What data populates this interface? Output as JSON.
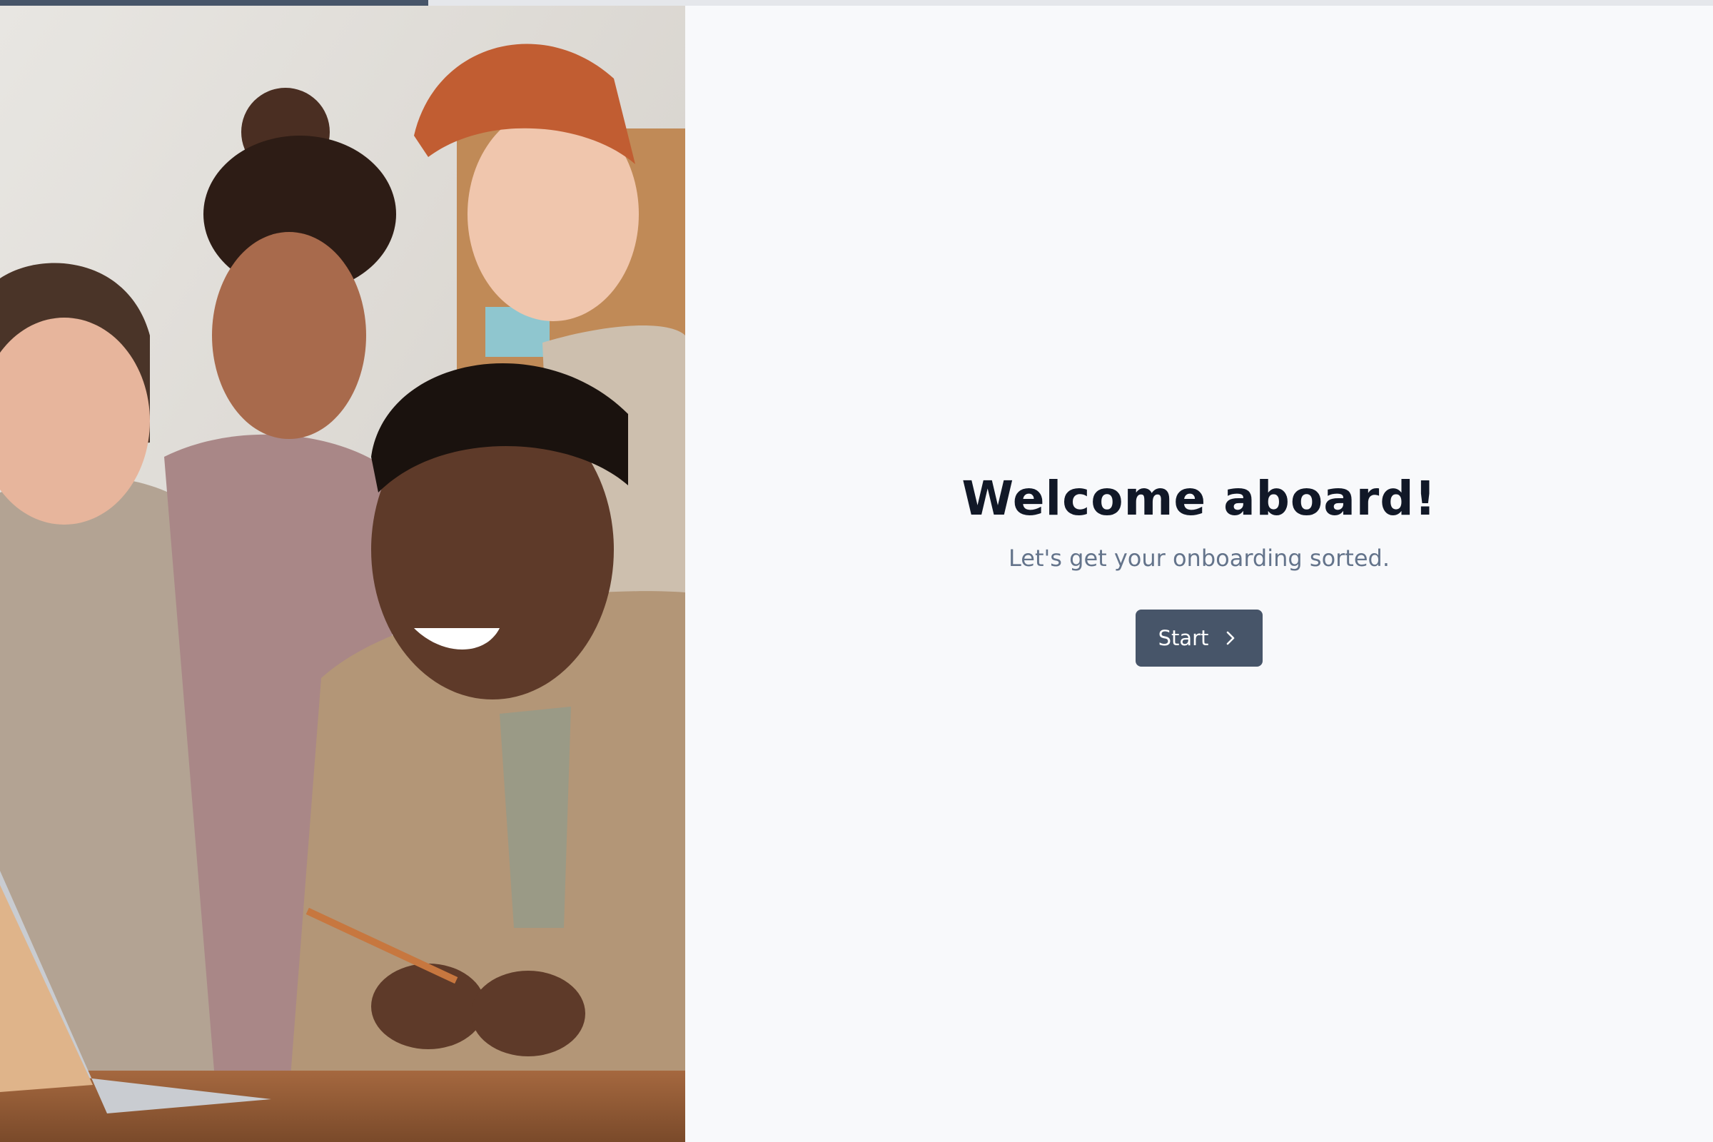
{
  "progress": {
    "fraction": 0.25,
    "color": "#475569",
    "track_color": "#e5e7eb"
  },
  "welcome": {
    "title": "Welcome aboard!",
    "subtitle": "Let's get your onboarding sorted."
  },
  "start_button": {
    "label": "Start",
    "icon": "chevron-right-icon",
    "background": "#475569"
  },
  "photo": {
    "subject": "team-photo"
  },
  "colors": {
    "background": "#f8f9fb",
    "title": "#111827",
    "subtitle": "#64748b"
  }
}
